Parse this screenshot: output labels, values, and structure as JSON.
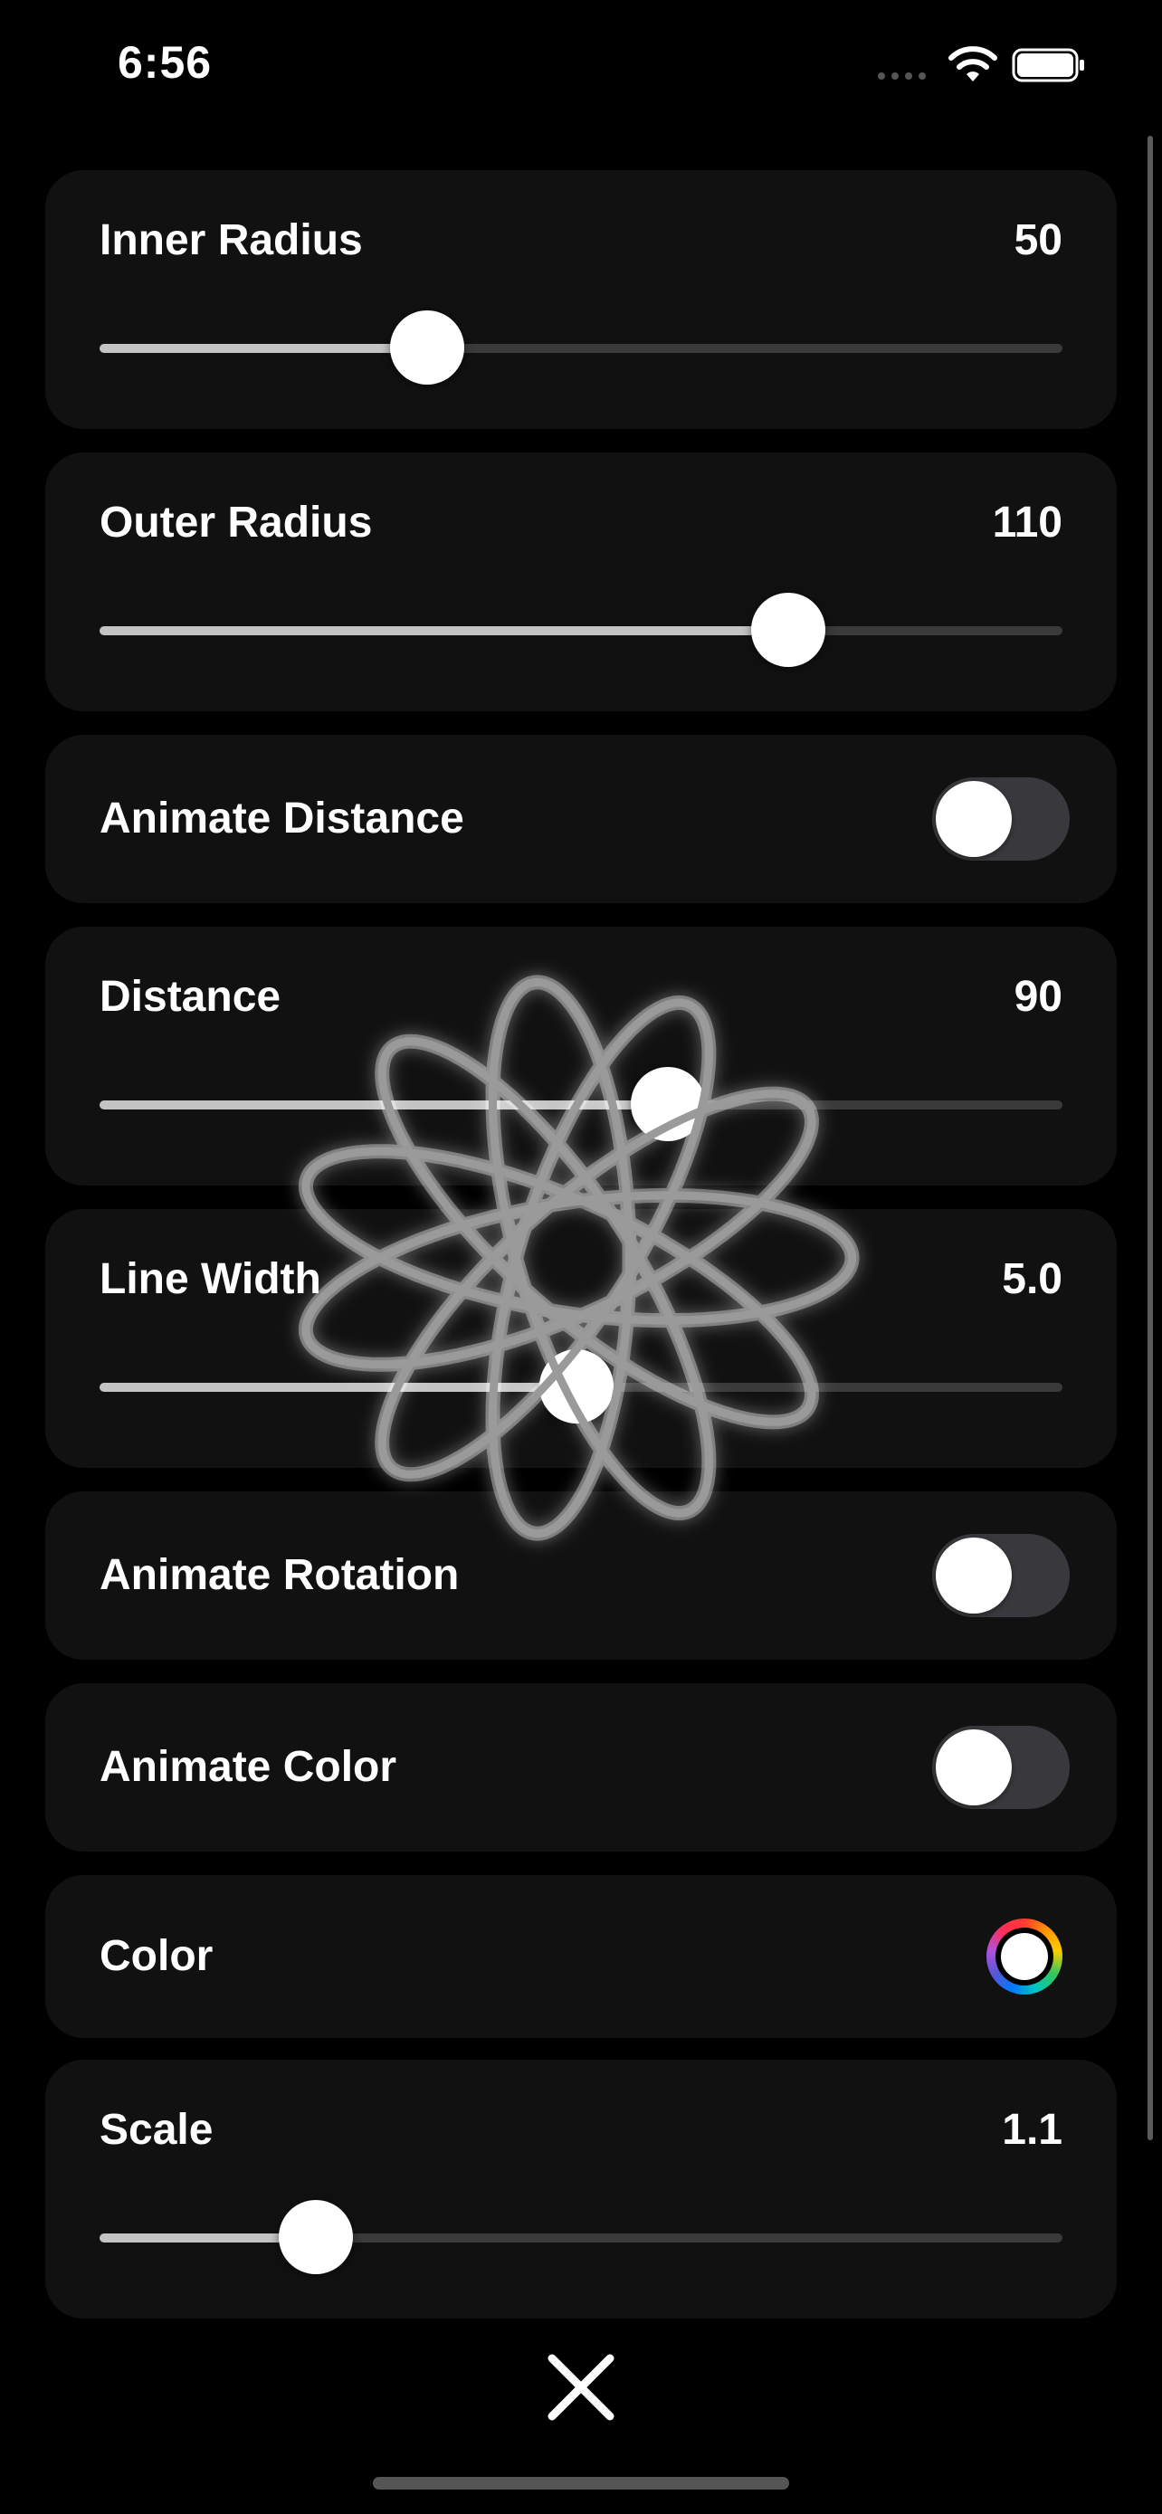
{
  "status_bar": {
    "time": "6:56",
    "icons": [
      "cellular-signal-icon",
      "wifi-icon",
      "battery-icon"
    ]
  },
  "controls": {
    "inner_radius": {
      "label": "Inner Radius",
      "value": "50",
      "fraction": 0.34
    },
    "outer_radius": {
      "label": "Outer Radius",
      "value": "110",
      "fraction": 0.715
    },
    "animate_distance": {
      "label": "Animate Distance",
      "on": false
    },
    "distance": {
      "label": "Distance",
      "value": "90",
      "fraction": 0.59
    },
    "line_width": {
      "label": "Line Width",
      "value": "5.0",
      "fraction": 0.495
    },
    "animate_rotation": {
      "label": "Animate Rotation",
      "on": false
    },
    "animate_color": {
      "label": "Animate Color",
      "on": false
    },
    "color": {
      "label": "Color",
      "value_color": "#ffffff"
    },
    "scale": {
      "label": "Scale",
      "value": "1.1",
      "fraction": 0.225
    }
  },
  "spirograph": {
    "stroke_color": "#9a9a9a",
    "glow_color": "#ffffff",
    "inner_radius": 50,
    "outer_radius": 110,
    "distance": 90,
    "line_width": 5.0,
    "scale": 1.1
  },
  "theme": {
    "background": "#000000",
    "panel": "#111111",
    "track_filled": "#c4c4c4",
    "track_empty": "#3a3a3a",
    "toggle_off": "#39393d"
  },
  "footer": {
    "close_icon": "close-icon"
  }
}
